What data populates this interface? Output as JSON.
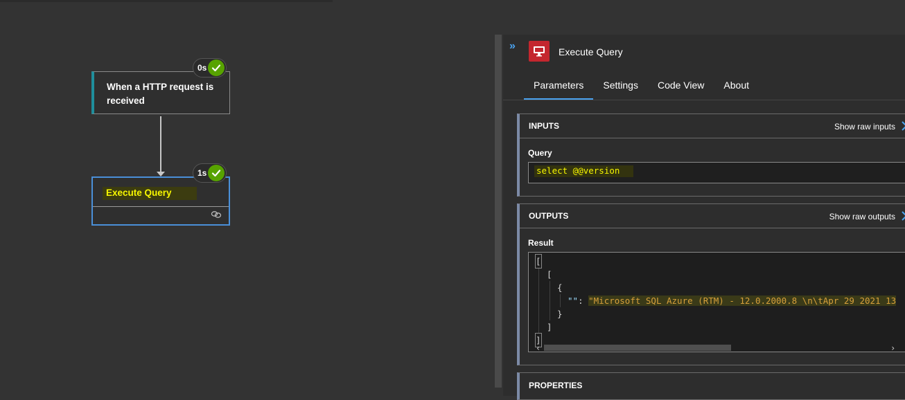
{
  "canvas": {
    "trigger": {
      "title": "When a HTTP request is received",
      "duration": "0s"
    },
    "action": {
      "title": "Execute Query",
      "duration": "1s"
    }
  },
  "panel": {
    "collapse_glyph": "»",
    "title": "Execute Query",
    "icon": "sql-database-icon",
    "tabs": [
      "Parameters",
      "Settings",
      "Code View",
      "About"
    ],
    "active_tab": "Parameters",
    "inputs": {
      "header": "INPUTS",
      "raw_link": "Show raw inputs",
      "query_label": "Query",
      "query_value": "select @@version"
    },
    "outputs": {
      "header": "OUTPUTS",
      "raw_link": "Show raw outputs",
      "result_label": "Result",
      "lines": {
        "l1": "[",
        "l2": "[",
        "l3": "{",
        "l4_key": "\"\"",
        "l4_sep": ": ",
        "l4_value": "\"Microsoft SQL Azure (RTM) - 12.0.2000.8 \\n\\tApr 29 2021 13",
        "l5": "}",
        "l6": "]",
        "l7": "]"
      }
    },
    "properties": {
      "header": "PROPERTIES"
    }
  },
  "colors": {
    "accent": "#4aa3f0",
    "success": "#57a300",
    "trigger_bar": "#1f8e9c",
    "highlight_text": "#f7f700",
    "sql_icon_bg": "#c4262e"
  }
}
